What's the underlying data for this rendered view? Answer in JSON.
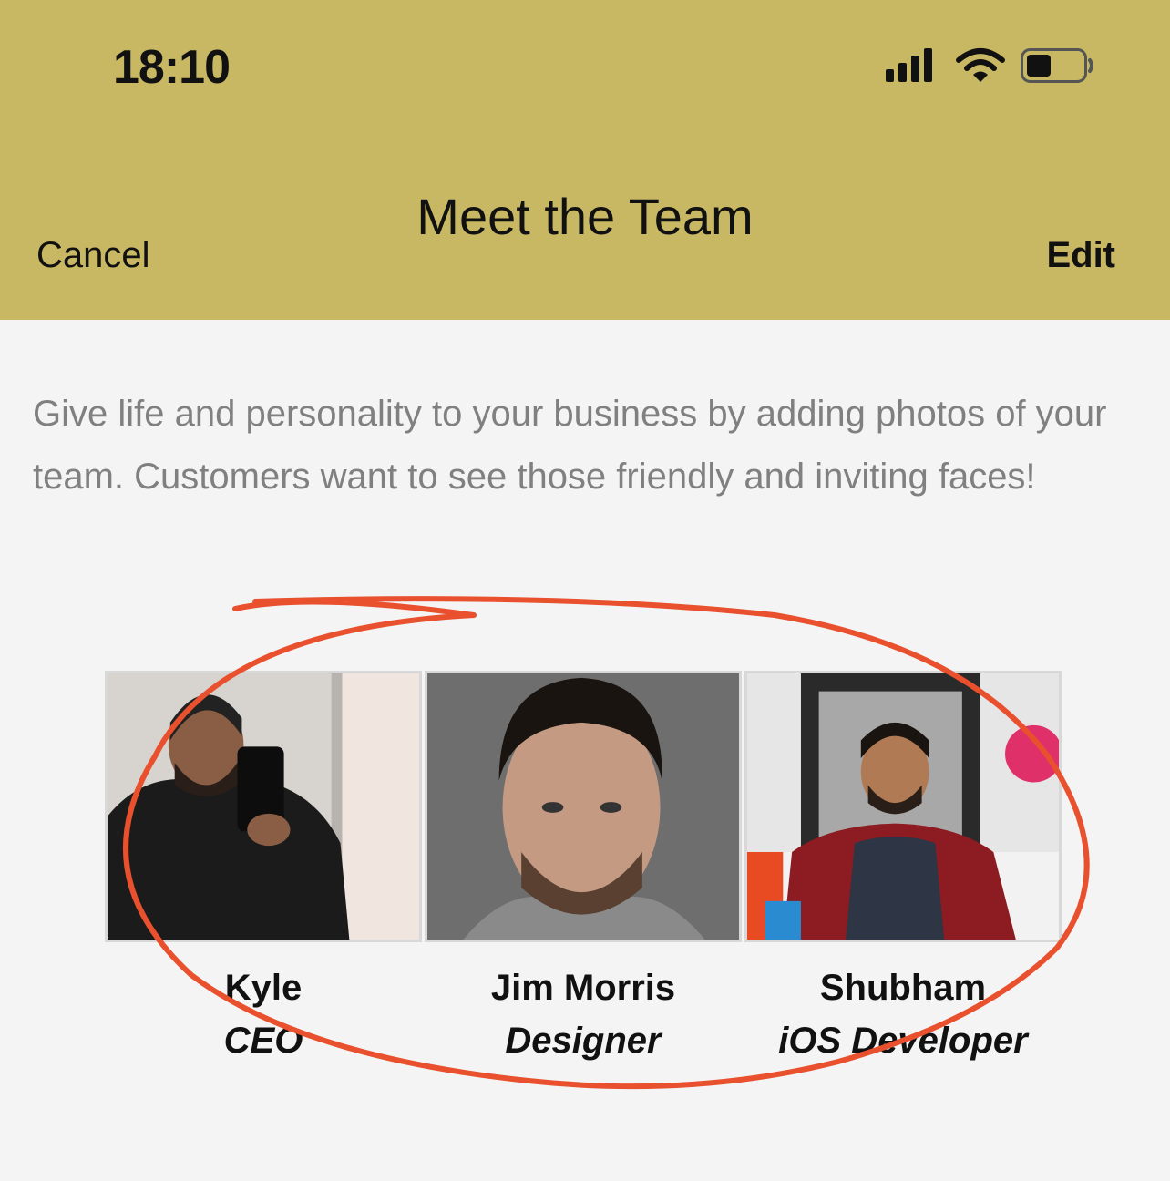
{
  "status_bar": {
    "time": "18:10"
  },
  "nav": {
    "title": "Meet the Team",
    "cancel_label": "Cancel",
    "edit_label": "Edit"
  },
  "description": "Give life and personality to your business by adding photos of your team. Customers want to see those friendly and inviting faces!",
  "team": [
    {
      "name": "Kyle",
      "role": "CEO"
    },
    {
      "name": "Jim Morris",
      "role": "Designer"
    },
    {
      "name": "Shubham",
      "role": "iOS Developer"
    }
  ],
  "colors": {
    "header": "#c9b863",
    "background": "#f4f4f4",
    "annotation": "#e8502e"
  }
}
